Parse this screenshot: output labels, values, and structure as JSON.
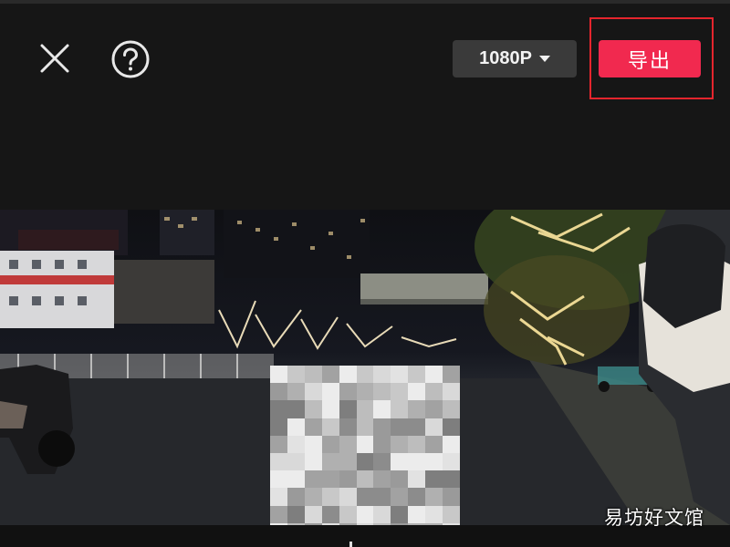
{
  "toolbar": {
    "close_icon": "close-icon",
    "help_icon": "help-icon",
    "resolution_label": "1080P",
    "export_label": "导出"
  },
  "preview": {
    "description_icon": "video-frame"
  },
  "watermark": "易坊好文馆",
  "colors": {
    "background": "#161616",
    "export_button": "#f1294f",
    "resolution_button": "#3a3a3a",
    "highlight_frame": "#e5252d"
  }
}
